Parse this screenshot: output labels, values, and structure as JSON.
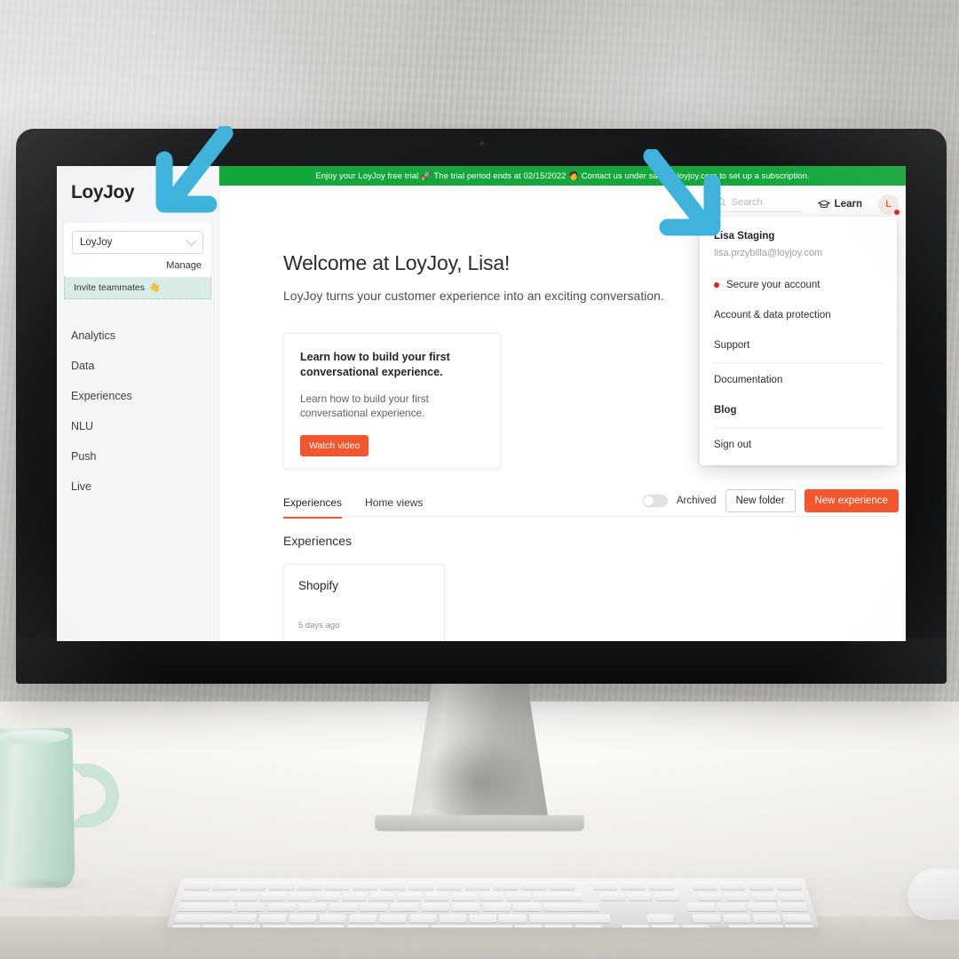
{
  "scene": {
    "description": "iMac on a white desk against a textured grey wall",
    "props": [
      "mint-mug",
      "white-keyboard",
      "white-mouse"
    ],
    "arrow_color": "#3fb3dc"
  },
  "banner": {
    "text": "Enjoy your LoyJoy free trial 🚀 The trial period ends at 02/15/2022 🧑 Contact us under sales@loyjoy.com to set up a subscription.",
    "background": "#14a83c"
  },
  "sidebar": {
    "logo": "LoyJoy",
    "workspace": {
      "selected": "LoyJoy",
      "manage_label": "Manage",
      "invite_label": "Invite teammates",
      "invite_emoji": "👋"
    },
    "items": [
      {
        "label": "Analytics"
      },
      {
        "label": "Data"
      },
      {
        "label": "Experiences"
      },
      {
        "label": "NLU"
      },
      {
        "label": "Push"
      },
      {
        "label": "Live"
      }
    ]
  },
  "topbar": {
    "search_placeholder": "Search",
    "learn_label": "Learn",
    "avatar_initial": "L"
  },
  "main": {
    "welcome_title": "Welcome at LoyJoy, Lisa!",
    "welcome_subtitle": "LoyJoy turns your customer experience into an exciting conversation.",
    "card": {
      "title": "Learn how to build your first conversational experience.",
      "body": "Learn how to build your first conversational experience.",
      "button": "Watch video"
    },
    "tabs": [
      {
        "label": "Experiences",
        "active": true
      },
      {
        "label": "Home views",
        "active": false
      }
    ],
    "toolbar": {
      "archived_label": "Archived",
      "archived_on": false,
      "new_folder_label": "New folder",
      "new_experience_label": "New experience"
    },
    "section_title": "Experiences",
    "experiences": [
      {
        "name": "Shopify",
        "meta": "5 days ago"
      }
    ]
  },
  "user_menu": {
    "name": "Lisa Staging",
    "email": "lisa.przybilla@loyjoy.com",
    "items": [
      {
        "label": "Secure your account",
        "dot": true,
        "bold": false,
        "sep_after": false
      },
      {
        "label": "Account & data protection",
        "dot": false,
        "bold": false,
        "sep_after": false
      },
      {
        "label": "Support",
        "dot": false,
        "bold": false,
        "sep_after": true
      },
      {
        "label": "Documentation",
        "dot": false,
        "bold": false,
        "sep_after": false
      },
      {
        "label": "Blog",
        "dot": false,
        "bold": true,
        "sep_after": true
      },
      {
        "label": "Sign out",
        "dot": false,
        "bold": false,
        "sep_after": false
      }
    ]
  },
  "colors": {
    "accent_orange": "#f3562c",
    "banner_green": "#14a83c",
    "alert_red": "#e8192c",
    "invite_teal": "#d9ece5"
  }
}
